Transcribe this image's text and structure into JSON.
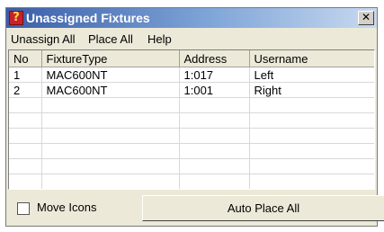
{
  "window": {
    "title": "Unassigned Fixtures",
    "close_glyph": "✕",
    "icon_glyph": "?"
  },
  "menu": [
    "Unassign All",
    "Place All",
    "Help"
  ],
  "table": {
    "columns": [
      "No",
      "FixtureType",
      "Address",
      "Username"
    ],
    "rows": [
      [
        "1",
        "MAC600NT",
        "1:017",
        "Left"
      ],
      [
        "2",
        "MAC600NT",
        "1:001",
        "Right"
      ]
    ]
  },
  "footer": {
    "checkbox_label": "Move Icons",
    "checkbox_checked": false,
    "button_label": "Auto Place All"
  }
}
